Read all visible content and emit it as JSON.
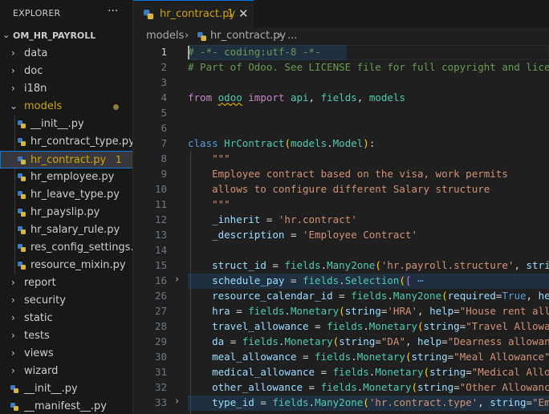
{
  "explorer": {
    "title": "EXPLORER",
    "more": "···",
    "section": "OM_HR_PAYROLL",
    "items": [
      {
        "label": "data",
        "kind": "folder"
      },
      {
        "label": "doc",
        "kind": "folder"
      },
      {
        "label": "i18n",
        "kind": "folder"
      },
      {
        "label": "models",
        "kind": "folder-open"
      },
      {
        "label": "__init__.py",
        "kind": "file"
      },
      {
        "label": "hr_contract_type.py",
        "kind": "file"
      },
      {
        "label": "hr_contract.py",
        "kind": "file",
        "badge": "1"
      },
      {
        "label": "hr_employee.py",
        "kind": "file"
      },
      {
        "label": "hr_leave_type.py",
        "kind": "file"
      },
      {
        "label": "hr_payslip.py",
        "kind": "file"
      },
      {
        "label": "hr_salary_rule.py",
        "kind": "file"
      },
      {
        "label": "res_config_settings.py",
        "kind": "file"
      },
      {
        "label": "resource_mixin.py",
        "kind": "file"
      },
      {
        "label": "report",
        "kind": "folder"
      },
      {
        "label": "security",
        "kind": "folder"
      },
      {
        "label": "static",
        "kind": "folder"
      },
      {
        "label": "tests",
        "kind": "folder"
      },
      {
        "label": "views",
        "kind": "folder"
      },
      {
        "label": "wizard",
        "kind": "folder"
      },
      {
        "label": "__init__.py",
        "kind": "file"
      },
      {
        "label": "__manifest__.py",
        "kind": "file"
      }
    ]
  },
  "tab": {
    "label": "hr_contract.py",
    "badge": "1",
    "close": "✕"
  },
  "breadcrumb": {
    "folder": "models",
    "sep": "›",
    "file": "hr_contract.py",
    "tail": "..."
  },
  "editor": {
    "line_numbers": [
      "1",
      "2",
      "3",
      "4",
      "5",
      "6",
      "7",
      "8",
      "9",
      "10",
      "11",
      "12",
      "13",
      "14",
      "15",
      "16",
      "26",
      "27",
      "28",
      "29",
      "30",
      "31",
      "32",
      "33"
    ]
  },
  "colors": {
    "accent": "#0078d4",
    "modified": "#cca700",
    "background": "#1f1f1f",
    "sidebar": "#181818"
  }
}
